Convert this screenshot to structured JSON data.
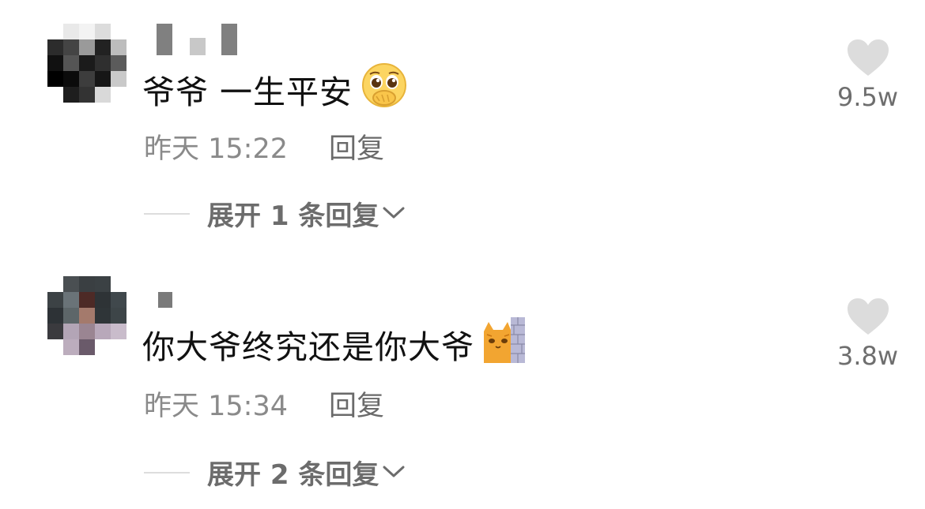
{
  "comments": [
    {
      "username_hidden": true,
      "text": "爷爷 一生平安",
      "emoji": "pleading-face-hands-over-mouth",
      "time": "昨天 15:22",
      "reply_label": "回复",
      "expand_label": "展开 1 条回复",
      "likes": "9.5w"
    },
    {
      "username_hidden": true,
      "text": "你大爷终究还是你大爷",
      "emoji": "cat-peeking-from-wall",
      "time": "昨天 15:34",
      "reply_label": "回复",
      "expand_label": "展开 2 条回复",
      "likes": "3.8w"
    }
  ],
  "icons": {
    "like": "heart-icon",
    "expand": "chevron-down-icon"
  },
  "colors": {
    "text": "#111111",
    "meta": "#8a8a8a",
    "heart": "#dcdcdc",
    "like_count": "#6e6e6e"
  }
}
